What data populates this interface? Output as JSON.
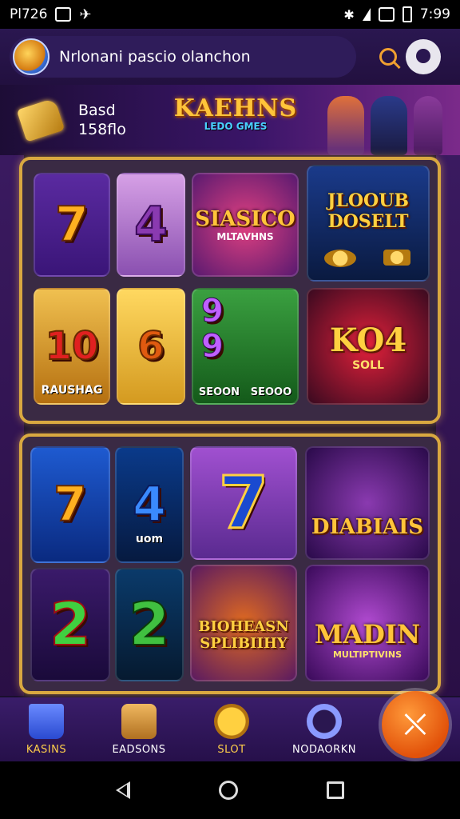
{
  "status_bar": {
    "left_text": "Pl726",
    "time": "7:99"
  },
  "header": {
    "search_text": "Nrlonani pascio olanchon",
    "search_icon": "search-icon",
    "profile_icon": "profile-icon"
  },
  "banner": {
    "line1": "Basd",
    "line2": "158flo",
    "logo_title": "KAEHNS",
    "logo_subtitle": "LEDO GMES"
  },
  "panel1": {
    "reels": [
      "7",
      "4",
      "10",
      "6"
    ],
    "bottom_left_label": "RAUSHAG",
    "tile_mid_top_title": "SIASICO",
    "tile_mid_top_sub": "MLTAVHNS",
    "tile_mid_bottom_labels": [
      "SEOON",
      "SEOOO"
    ],
    "tile_right_top_title": "JLOOUB DOSELT",
    "tile_right_bottom_title": "KO4",
    "tile_right_bottom_sub": "SOLL"
  },
  "panel2": {
    "reels": [
      "7",
      "4",
      "2",
      "2"
    ],
    "reel_caption": "uom",
    "tile_mid_bottom_title": "BIOHEASN SPLIBIIHY",
    "tile_right_top_title": "DIABIAIS",
    "tile_right_bottom_title": "MADIN",
    "tile_right_bottom_sub": "MULTIPTIVINS"
  },
  "bottom_nav": {
    "items": [
      {
        "label": "KASINS",
        "icon": "bucket-icon"
      },
      {
        "label": "EADSONS",
        "icon": "briefcase-icon"
      },
      {
        "label": "SLOT",
        "icon": "coin-icon"
      },
      {
        "label": "NODAORKN",
        "icon": "search-circle-icon"
      }
    ],
    "fab_icon": "x-icon"
  },
  "colors": {
    "accent": "#f0a030",
    "frame_gold": "#d9a840",
    "nav_bg": "#2f1757"
  }
}
